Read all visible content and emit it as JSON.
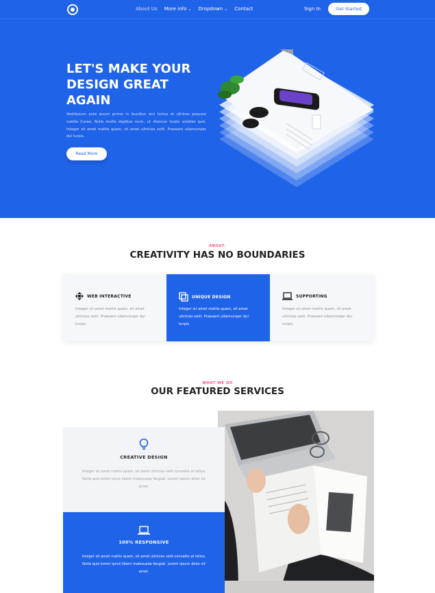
{
  "nav": {
    "links": [
      "About Us",
      "More info",
      "Dropdown",
      "Contact"
    ],
    "signin": "Sign In",
    "cta": "Get Started"
  },
  "hero": {
    "title": "LET'S MAKE YOUR DESIGN GREAT AGAIN",
    "text": "Vestibulum ante ipsum primis in faucibus orci luctus et ultrices posuere cubilia Curae; Nulla mollis dapibus nunc, ut rhoncus turpis sodales quis. Integer sit amet mattis quam, sit amet ultricies velit. Praesent ullamcorper dui turpis.",
    "button": "Read More"
  },
  "about": {
    "eyebrow": "ABOUT.",
    "title": "CREATIVITY HAS NO BOUNDARIES",
    "features": [
      {
        "icon": "move-arrows-icon",
        "name": "WEB INTERACTIVE",
        "text": "Integer sit amet mattis quam, sit amet ultricies velit. Praesent ullamcorper dui turpis."
      },
      {
        "icon": "layers-copy-icon",
        "name": "UNIQUE DESIGN",
        "text": "Integer sit amet mattis quam, sit amet ultricies velit. Praesent ullamcorper dui turpis."
      },
      {
        "icon": "laptop-icon",
        "name": "SUPPORTING",
        "text": "Integer sit amet mattis quam, sit amet ultricies velit. Praesent ullamcorper dui turpis."
      }
    ]
  },
  "services": {
    "eyebrow": "WHAT WE DO",
    "title": "OUR FEATURED SERVICES",
    "items": [
      {
        "icon": "lightbulb-icon",
        "name": "CREATIVE DESIGN",
        "text": "Integer sit amet mattis quam, sit amet ultricies velit.convallis at tellus. Nulla quis lorem ipnut libero malesuada feugiat. Lorem ipsum dolor sit amet."
      },
      {
        "icon": "laptop-icon",
        "name": "100% RESPONSIVE",
        "text": "Integer sit amet mattis quam, sit amet ultricies velit.convallis at tellus. Nulla quis lorem ipnut libero malesuada feugiat. Lorem ipsum dolor sit amet."
      }
    ]
  },
  "colors": {
    "primary": "#1f63e9",
    "accent": "#ff4f7b"
  }
}
